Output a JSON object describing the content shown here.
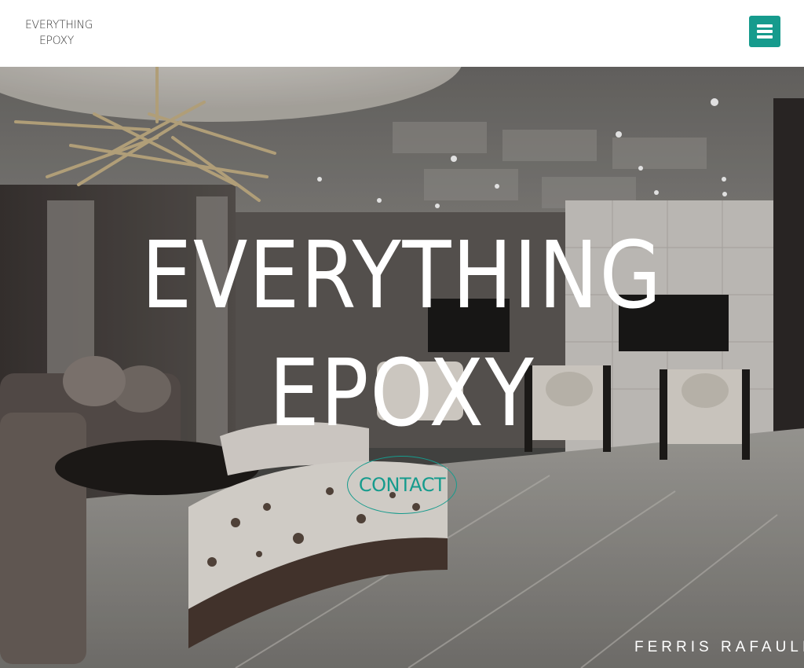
{
  "header": {
    "brand_line1": "EVERYTHING",
    "brand_line2": "EPOXY",
    "menu_icon": "hamburger-icon",
    "accent_color": "#169b8d"
  },
  "hero": {
    "title_line1": "EVERYTHING",
    "title_line2": "EPOXY",
    "contact_label": "CONTACT",
    "photo_watermark": "FERRIS RAFAULI"
  }
}
